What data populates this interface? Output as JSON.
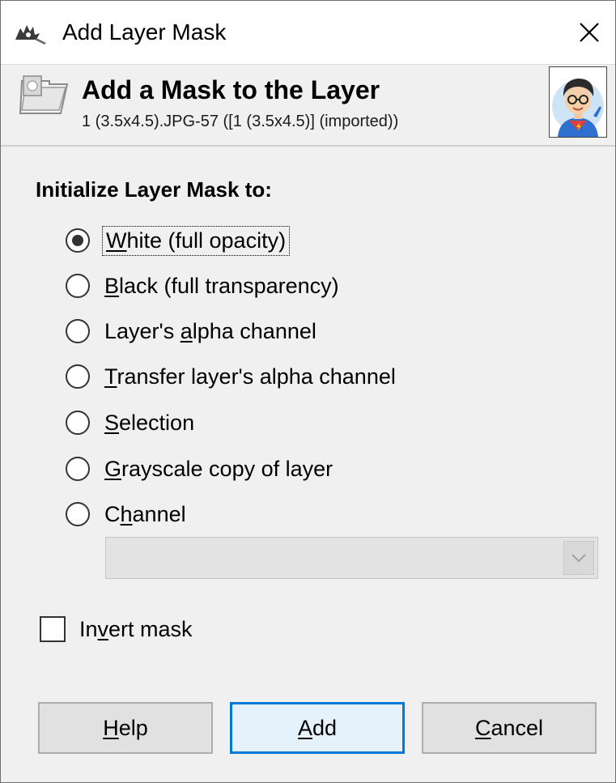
{
  "window": {
    "title": "Add Layer Mask",
    "close_glyph": "✕"
  },
  "header": {
    "title": "Add a Mask to the Layer",
    "subtitle": "1 (3.5x4.5).JPG-57 ([1 (3.5x4.5)] (imported))"
  },
  "icons": {
    "app": "gimp-wilber-icon",
    "header": "layer-mask-icon",
    "avatar": "user-avatar",
    "combo_arrow": "chevron-down-icon"
  },
  "options": {
    "label": "Initialize Layer Mask to:",
    "selected_index": 0,
    "items": [
      {
        "pre": "",
        "key": "W",
        "post": "hite (full opacity)"
      },
      {
        "pre": "",
        "key": "B",
        "post": "lack (full transparency)"
      },
      {
        "pre": "Layer's ",
        "key": "a",
        "post": "lpha channel"
      },
      {
        "pre": "",
        "key": "T",
        "post": "ransfer layer's alpha channel"
      },
      {
        "pre": "",
        "key": "S",
        "post": "election"
      },
      {
        "pre": "",
        "key": "G",
        "post": "rayscale copy of layer"
      },
      {
        "pre": "C",
        "key": "h",
        "post": "annel"
      }
    ]
  },
  "channel_combo": {
    "value": "",
    "disabled": true
  },
  "invert": {
    "pre": "In",
    "key": "v",
    "post": "ert mask",
    "checked": false
  },
  "buttons": {
    "help": {
      "pre": "",
      "key": "H",
      "post": "elp"
    },
    "add": {
      "pre": "",
      "key": "A",
      "post": "dd"
    },
    "cancel": {
      "pre": "",
      "key": "C",
      "post": "ancel"
    }
  },
  "colors": {
    "dialog_bg": "#f0f0f0",
    "default_button_border": "#0078d7",
    "default_button_bg": "#e5f1fb"
  }
}
